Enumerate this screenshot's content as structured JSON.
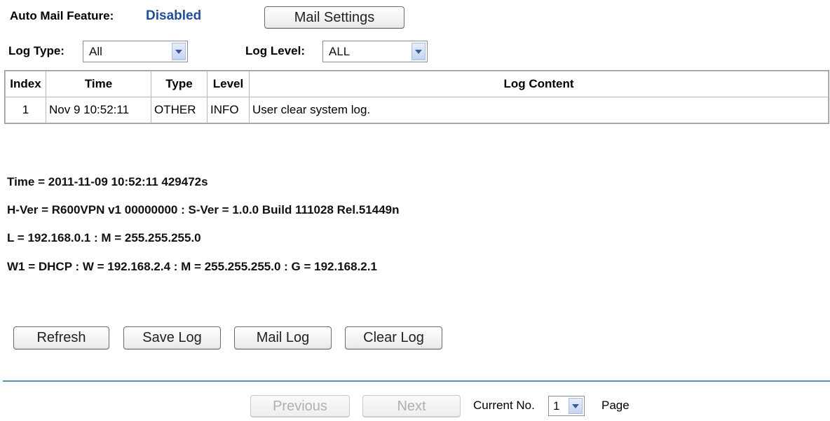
{
  "auto_mail": {
    "label": "Auto Mail Feature:",
    "status": "Disabled",
    "settings_button": "Mail Settings"
  },
  "filters": {
    "log_type_label": "Log Type:",
    "log_type_value": "All",
    "log_level_label": "Log Level:",
    "log_level_value": "ALL"
  },
  "table": {
    "headers": [
      "Index",
      "Time",
      "Type",
      "Level",
      "Log Content"
    ],
    "rows": [
      {
        "index": "1",
        "time": "Nov 9 10:52:11",
        "type": "OTHER",
        "level": "INFO",
        "content": "User clear system log."
      }
    ]
  },
  "info": {
    "time": "Time = 2011-11-09 10:52:11 429472s",
    "version": "H-Ver = R600VPN v1 00000000 : S-Ver = 1.0.0 Build 111028 Rel.51449n",
    "lan": "L = 192.168.0.1 : M = 255.255.255.0",
    "wan": "W1 = DHCP : W = 192.168.2.4 : M = 255.255.255.0 : G = 192.168.2.1"
  },
  "actions": {
    "refresh": "Refresh",
    "save": "Save Log",
    "mail": "Mail Log",
    "clear": "Clear Log"
  },
  "pagination": {
    "previous": "Previous",
    "next": "Next",
    "current_label": "Current No.",
    "current_value": "1",
    "page_label": "Page"
  },
  "colors": {
    "status_blue": "#1f4f9c",
    "divider": "#5a8fb0"
  }
}
